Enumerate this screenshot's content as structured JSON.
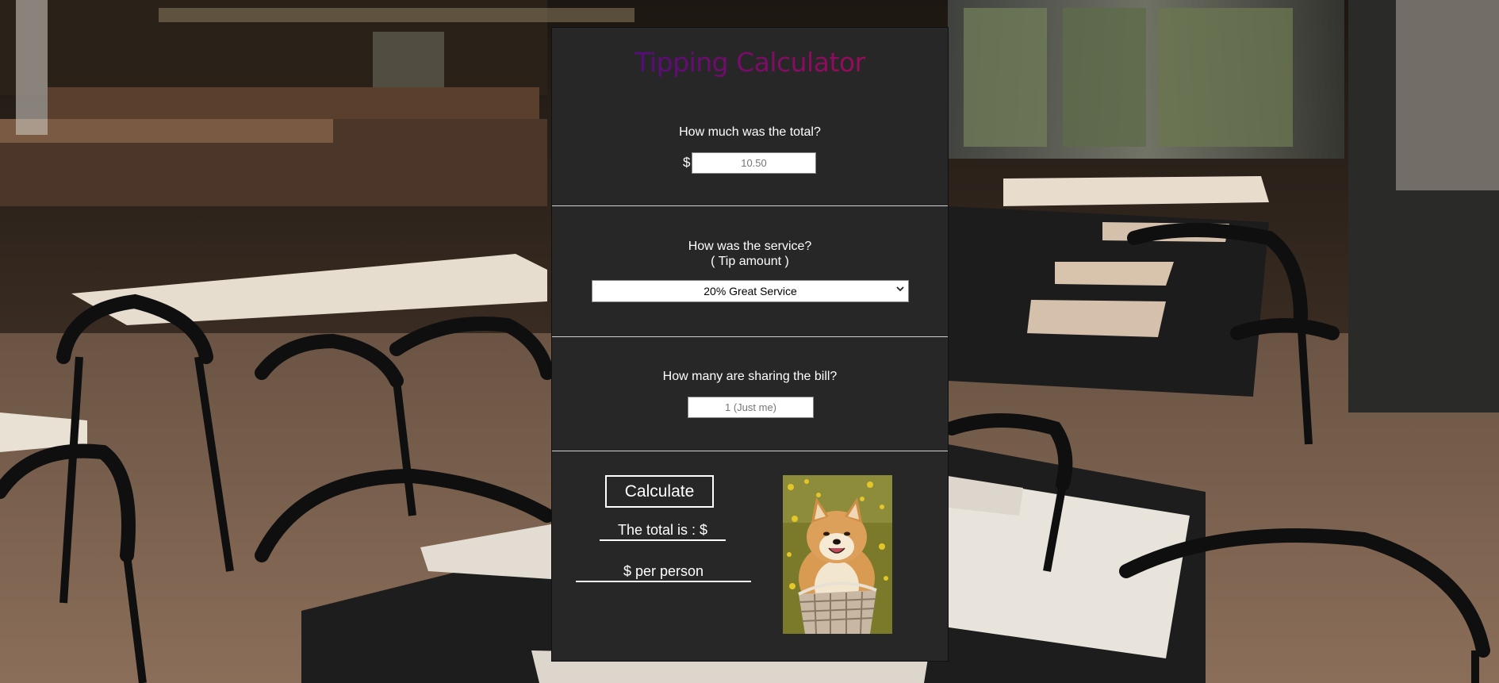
{
  "app": {
    "title": "Tipping Calculator"
  },
  "bill": {
    "question": "How much was the total?",
    "currency_symbol": "$",
    "placeholder": "10.50"
  },
  "service": {
    "question_line1": "How was the service?",
    "question_line2": "( Tip amount )",
    "selected_option": "20% Great Service",
    "arrow_icon": "chevron-down-icon"
  },
  "people": {
    "question": "How many are sharing the bill?",
    "placeholder": "1 (Just me)"
  },
  "results": {
    "calculate_label": "Calculate",
    "total_label": "The total is : $",
    "per_person_label": "$ per person"
  },
  "colors": {
    "panel_bg": "#272727",
    "title_gradient_start": "#3b0d8c",
    "title_gradient_end": "#b00b4f",
    "text": "#ffffff"
  }
}
